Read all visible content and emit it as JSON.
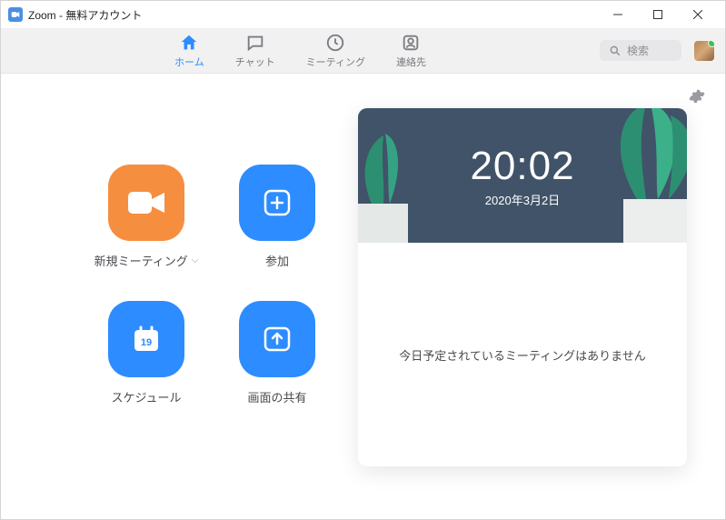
{
  "window": {
    "title": "Zoom - 無料アカウント"
  },
  "nav": {
    "home": "ホーム",
    "chat": "チャット",
    "meetings": "ミーティング",
    "contacts": "連絡先"
  },
  "search": {
    "placeholder": "検索"
  },
  "actions": {
    "new_meeting": "新規ミーティング",
    "join": "参加",
    "schedule": "スケジュール",
    "share_screen": "画面の共有",
    "schedule_day": "19"
  },
  "hero": {
    "time": "20:02",
    "date": "2020年3月2日"
  },
  "body": {
    "empty_message": "今日予定されているミーティングはありません"
  }
}
